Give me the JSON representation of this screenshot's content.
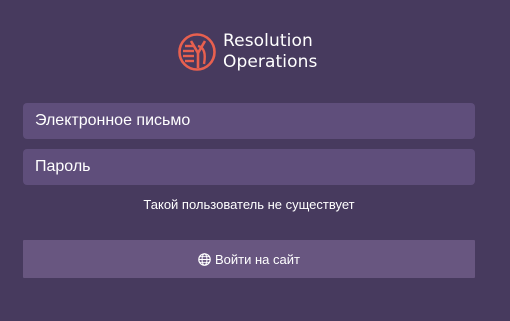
{
  "brand": {
    "name_line1": "Resolution",
    "name_line2": "Operations",
    "logo_icon": "resolution-logo-icon",
    "accent_color": "#e8604f"
  },
  "form": {
    "email_placeholder": "Электронное письмо",
    "password_placeholder": "Пароль",
    "error_message": "Такой пользователь не существует",
    "submit_label": "Войти на сайт",
    "submit_icon": "globe-icon"
  },
  "colors": {
    "background": "#473a5e",
    "input_background": "#5f4e7b",
    "button_background": "#685680",
    "text": "#ffffff"
  }
}
